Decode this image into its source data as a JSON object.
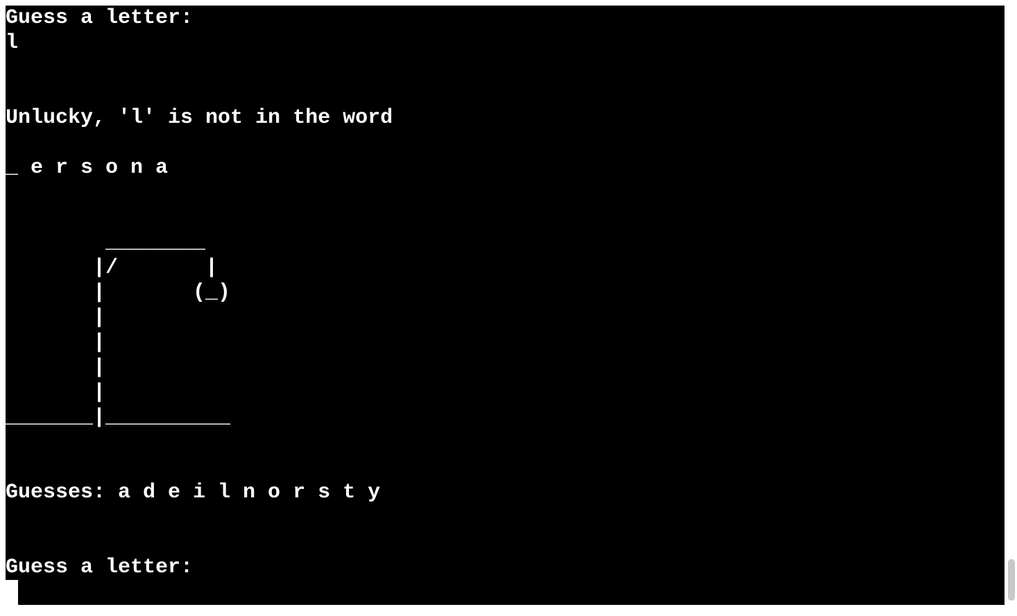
{
  "terminal": {
    "lines": [
      "Guess a letter:",
      "l",
      "",
      "",
      "Unlucky, 'l' is not in the word",
      "",
      "_ e r s o n a",
      "",
      "",
      "        ________",
      "       |/       |",
      "       |       (_)",
      "       |",
      "       |",
      "       |",
      "       |",
      "_______|__________",
      "",
      "",
      "Guesses: a d e i l n o r s t y",
      "",
      "",
      "Guess a letter:"
    ]
  }
}
